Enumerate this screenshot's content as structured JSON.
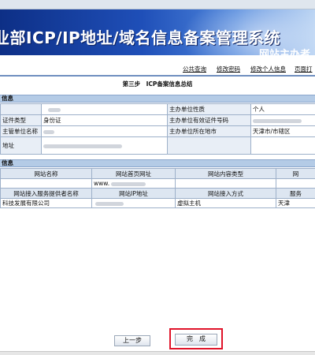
{
  "header": {
    "title": "业部ICP/IP地址/域名信息备案管理系统",
    "subtitle": "网站主办者"
  },
  "nav": {
    "public_query": "公共查询",
    "change_password": "修改密码",
    "change_personal_info": "修改个人信息",
    "page_print": "页面打"
  },
  "step_title": "第三步　ICP备案信息总结",
  "section1": {
    "title": "信息",
    "rows": [
      {
        "label": "",
        "value": "",
        "label2": "主办单位性质",
        "value2": "个人"
      },
      {
        "label": "证件类型",
        "value": "身份证",
        "label2": "主办单位有效证件号码",
        "value2": ""
      },
      {
        "label": "主管单位名称",
        "value": "",
        "label2": "主办单位所在地市",
        "value2": "天津市/市辖区"
      },
      {
        "label": "地址",
        "value": "",
        "label2": "",
        "value2": ""
      }
    ]
  },
  "section2": {
    "title": "信息",
    "headers1": [
      "网站名称",
      "网站首页网址",
      "网站内容类型",
      "网"
    ],
    "row1": [
      "",
      "www.",
      "",
      ""
    ],
    "headers2": [
      "网站接入服务提供者名称",
      "网站IP地址",
      "网站接入方式",
      "服务"
    ],
    "row2": [
      "科技发展有限公司",
      "",
      "虚拟主机",
      "天津"
    ]
  },
  "buttons": {
    "prev": "上一步",
    "finish": "完　成"
  },
  "colors": {
    "banner_dark": "#0d2f86",
    "section_bar": "#b4cbe6",
    "highlight_border": "#e0142a"
  }
}
